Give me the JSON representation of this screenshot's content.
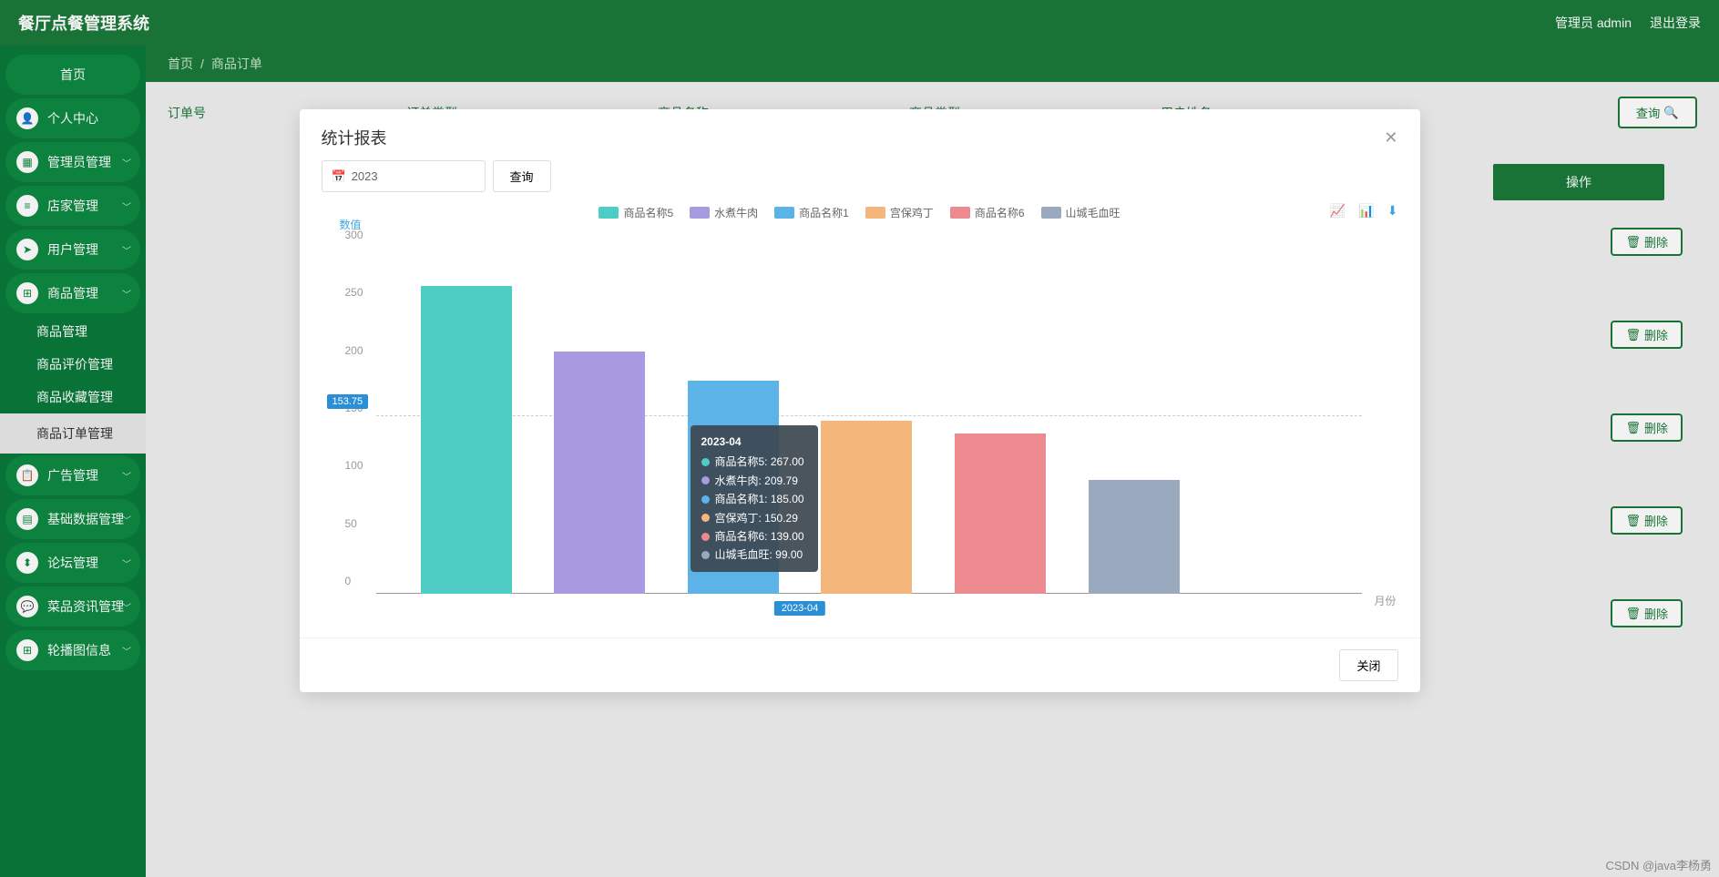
{
  "app_title": "餐厅点餐管理系统",
  "header": {
    "admin_label": "管理员 admin",
    "logout": "退出登录"
  },
  "sidebar": {
    "items": [
      {
        "label": "首页",
        "icon": ""
      },
      {
        "label": "个人中心",
        "icon": "user"
      },
      {
        "label": "管理员管理",
        "icon": "briefcase"
      },
      {
        "label": "店家管理",
        "icon": "list"
      },
      {
        "label": "用户管理",
        "icon": "send"
      },
      {
        "label": "商品管理",
        "icon": "grid",
        "expanded": true
      },
      {
        "label": "广告管理",
        "icon": "clipboard"
      },
      {
        "label": "基础数据管理",
        "icon": "bars"
      },
      {
        "label": "论坛管理",
        "icon": "chart"
      },
      {
        "label": "菜品资讯管理",
        "icon": "comment"
      },
      {
        "label": "轮播图信息",
        "icon": "grid"
      }
    ],
    "sub_items": [
      "商品管理",
      "商品评价管理",
      "商品收藏管理",
      "商品订单管理"
    ]
  },
  "breadcrumb": {
    "home": "首页",
    "sep": "/",
    "current": "商品订单"
  },
  "filters": {
    "c1": "订单号",
    "c2": "订单类型",
    "c3": "商品名称",
    "c4": "商品类型",
    "c5": "用户姓名",
    "query": "查询"
  },
  "table": {
    "op_header": "操作",
    "delete": "删除"
  },
  "modal": {
    "title": "统计报表",
    "year_value": "2023",
    "query_btn": "查询",
    "close_btn": "关闭"
  },
  "chart_data": {
    "type": "bar",
    "title": "",
    "xlabel": "月份",
    "ylabel": "数值",
    "ylim": [
      0,
      300
    ],
    "y_ticks": [
      0,
      50,
      100,
      150,
      200,
      250,
      300
    ],
    "y_hint": "153.75",
    "categories": [
      "2023-04"
    ],
    "x_tick_label": "2023-04",
    "series": [
      {
        "name": "商品名称5",
        "color": "#4ecdc4",
        "values": [
          267.0
        ]
      },
      {
        "name": "水煮牛肉",
        "color": "#a89ae0",
        "values": [
          209.79
        ]
      },
      {
        "name": "商品名称1",
        "color": "#5bb3e8",
        "values": [
          185.0
        ]
      },
      {
        "name": "宫保鸡丁",
        "color": "#f4b67a",
        "values": [
          150.29
        ]
      },
      {
        "name": "商品名称6",
        "color": "#ec8a8f",
        "values": [
          139.0
        ]
      },
      {
        "name": "山城毛血旺",
        "color": "#9aa9bd",
        "values": [
          99.0
        ]
      }
    ],
    "tooltip_title": "2023-04"
  },
  "watermark": "CSDN @java李杨勇"
}
